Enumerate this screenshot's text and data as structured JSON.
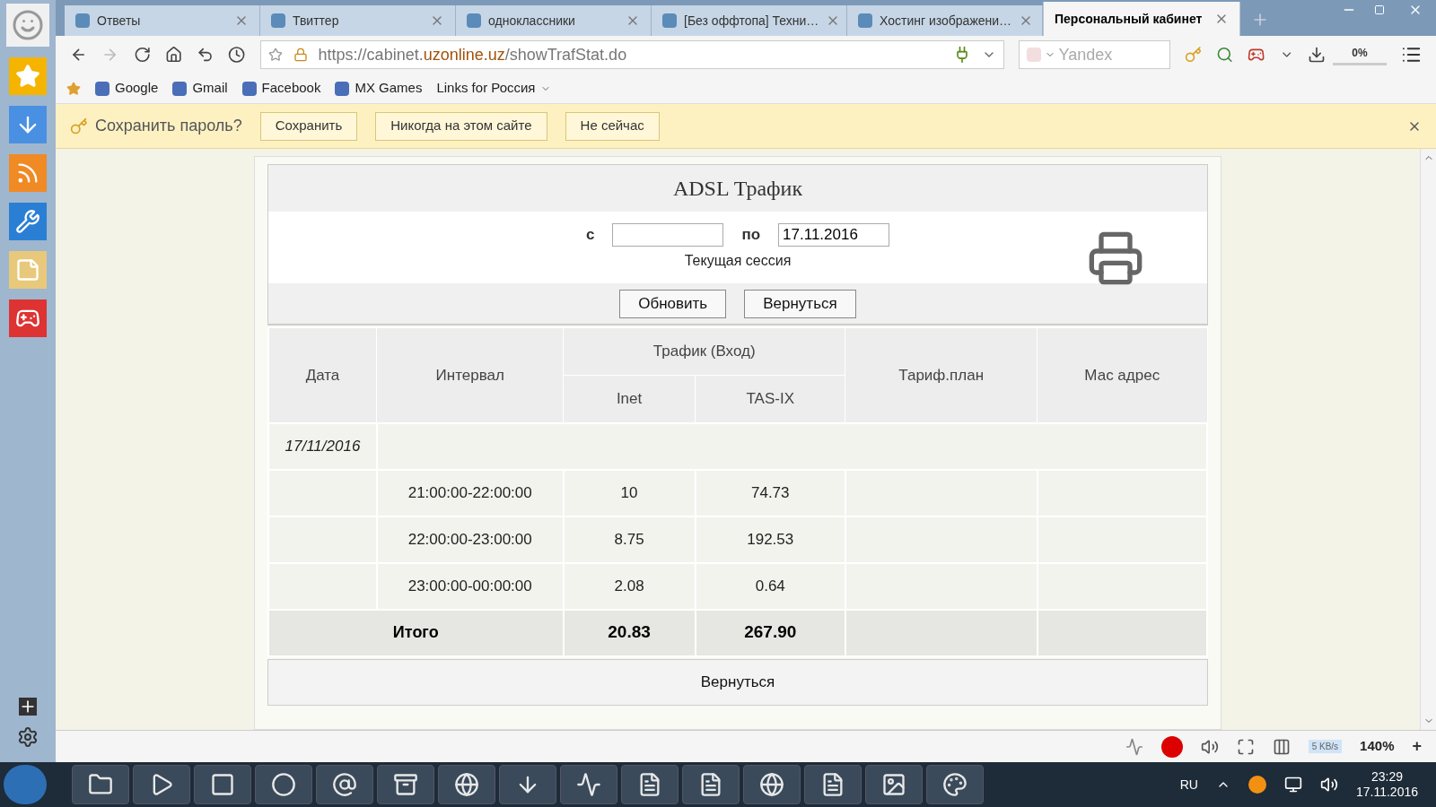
{
  "tabs": [
    {
      "label": "Ответы",
      "selected": false
    },
    {
      "label": "Твиттер",
      "selected": false
    },
    {
      "label": "одноклассники",
      "selected": false
    },
    {
      "label": "[Без оффтопа] Техни…",
      "selected": false
    },
    {
      "label": "Хостинг изображени…",
      "selected": false
    },
    {
      "label": "Персональный кабинет",
      "selected": true
    }
  ],
  "address": {
    "prefix": "https://cabinet.",
    "domain": "uzonline.uz",
    "path": "/showTrafStat.do"
  },
  "search": {
    "placeholder": "Yandex"
  },
  "download_progress": {
    "text": "0%",
    "level": 0
  },
  "bookmarks": [
    {
      "label": "Google",
      "kind": "site"
    },
    {
      "label": "Gmail",
      "kind": "site"
    },
    {
      "label": "Facebook",
      "kind": "site"
    },
    {
      "label": "MX Games",
      "kind": "site"
    },
    {
      "label": "Links for Россия",
      "kind": "folder"
    }
  ],
  "password_bar": {
    "prompt": "Сохранить пароль?",
    "buttons": [
      "Сохранить",
      "Никогда на этом сайте",
      "Не сейчас"
    ]
  },
  "page": {
    "title": "ADSL Трафик",
    "from_label": "с",
    "to_label": "по",
    "to_value": "17.11.2016",
    "session": "Текущая сессия",
    "buttons": [
      "Обновить",
      "Вернуться"
    ],
    "footer_button": "Вернуться"
  },
  "table": {
    "columns": {
      "date": "Дата",
      "interval": "Интервал",
      "traffic": "Трафик (Вход)",
      "inet": "Inet",
      "tasix": "TAS-IX",
      "plan": "Тариф.план",
      "mac": "Мас адрес"
    },
    "date_row": "17/11/2016",
    "rows": [
      {
        "interval": "21:00:00-22:00:00",
        "inet": "10",
        "tasix": "74.73"
      },
      {
        "interval": "22:00:00-23:00:00",
        "inet": "8.75",
        "tasix": "192.53"
      },
      {
        "interval": "23:00:00-00:00:00",
        "inet": "2.08",
        "tasix": "0.64"
      }
    ],
    "total": {
      "label": "Итого",
      "inet": "20.83",
      "tasix": "267.90"
    }
  },
  "status_bar": {
    "speed": "5 KB/s",
    "zoom": "140%",
    "zoom_in": "+"
  },
  "taskbar": {
    "language": "RU",
    "time": "23:29",
    "date": "17.11.2016"
  }
}
